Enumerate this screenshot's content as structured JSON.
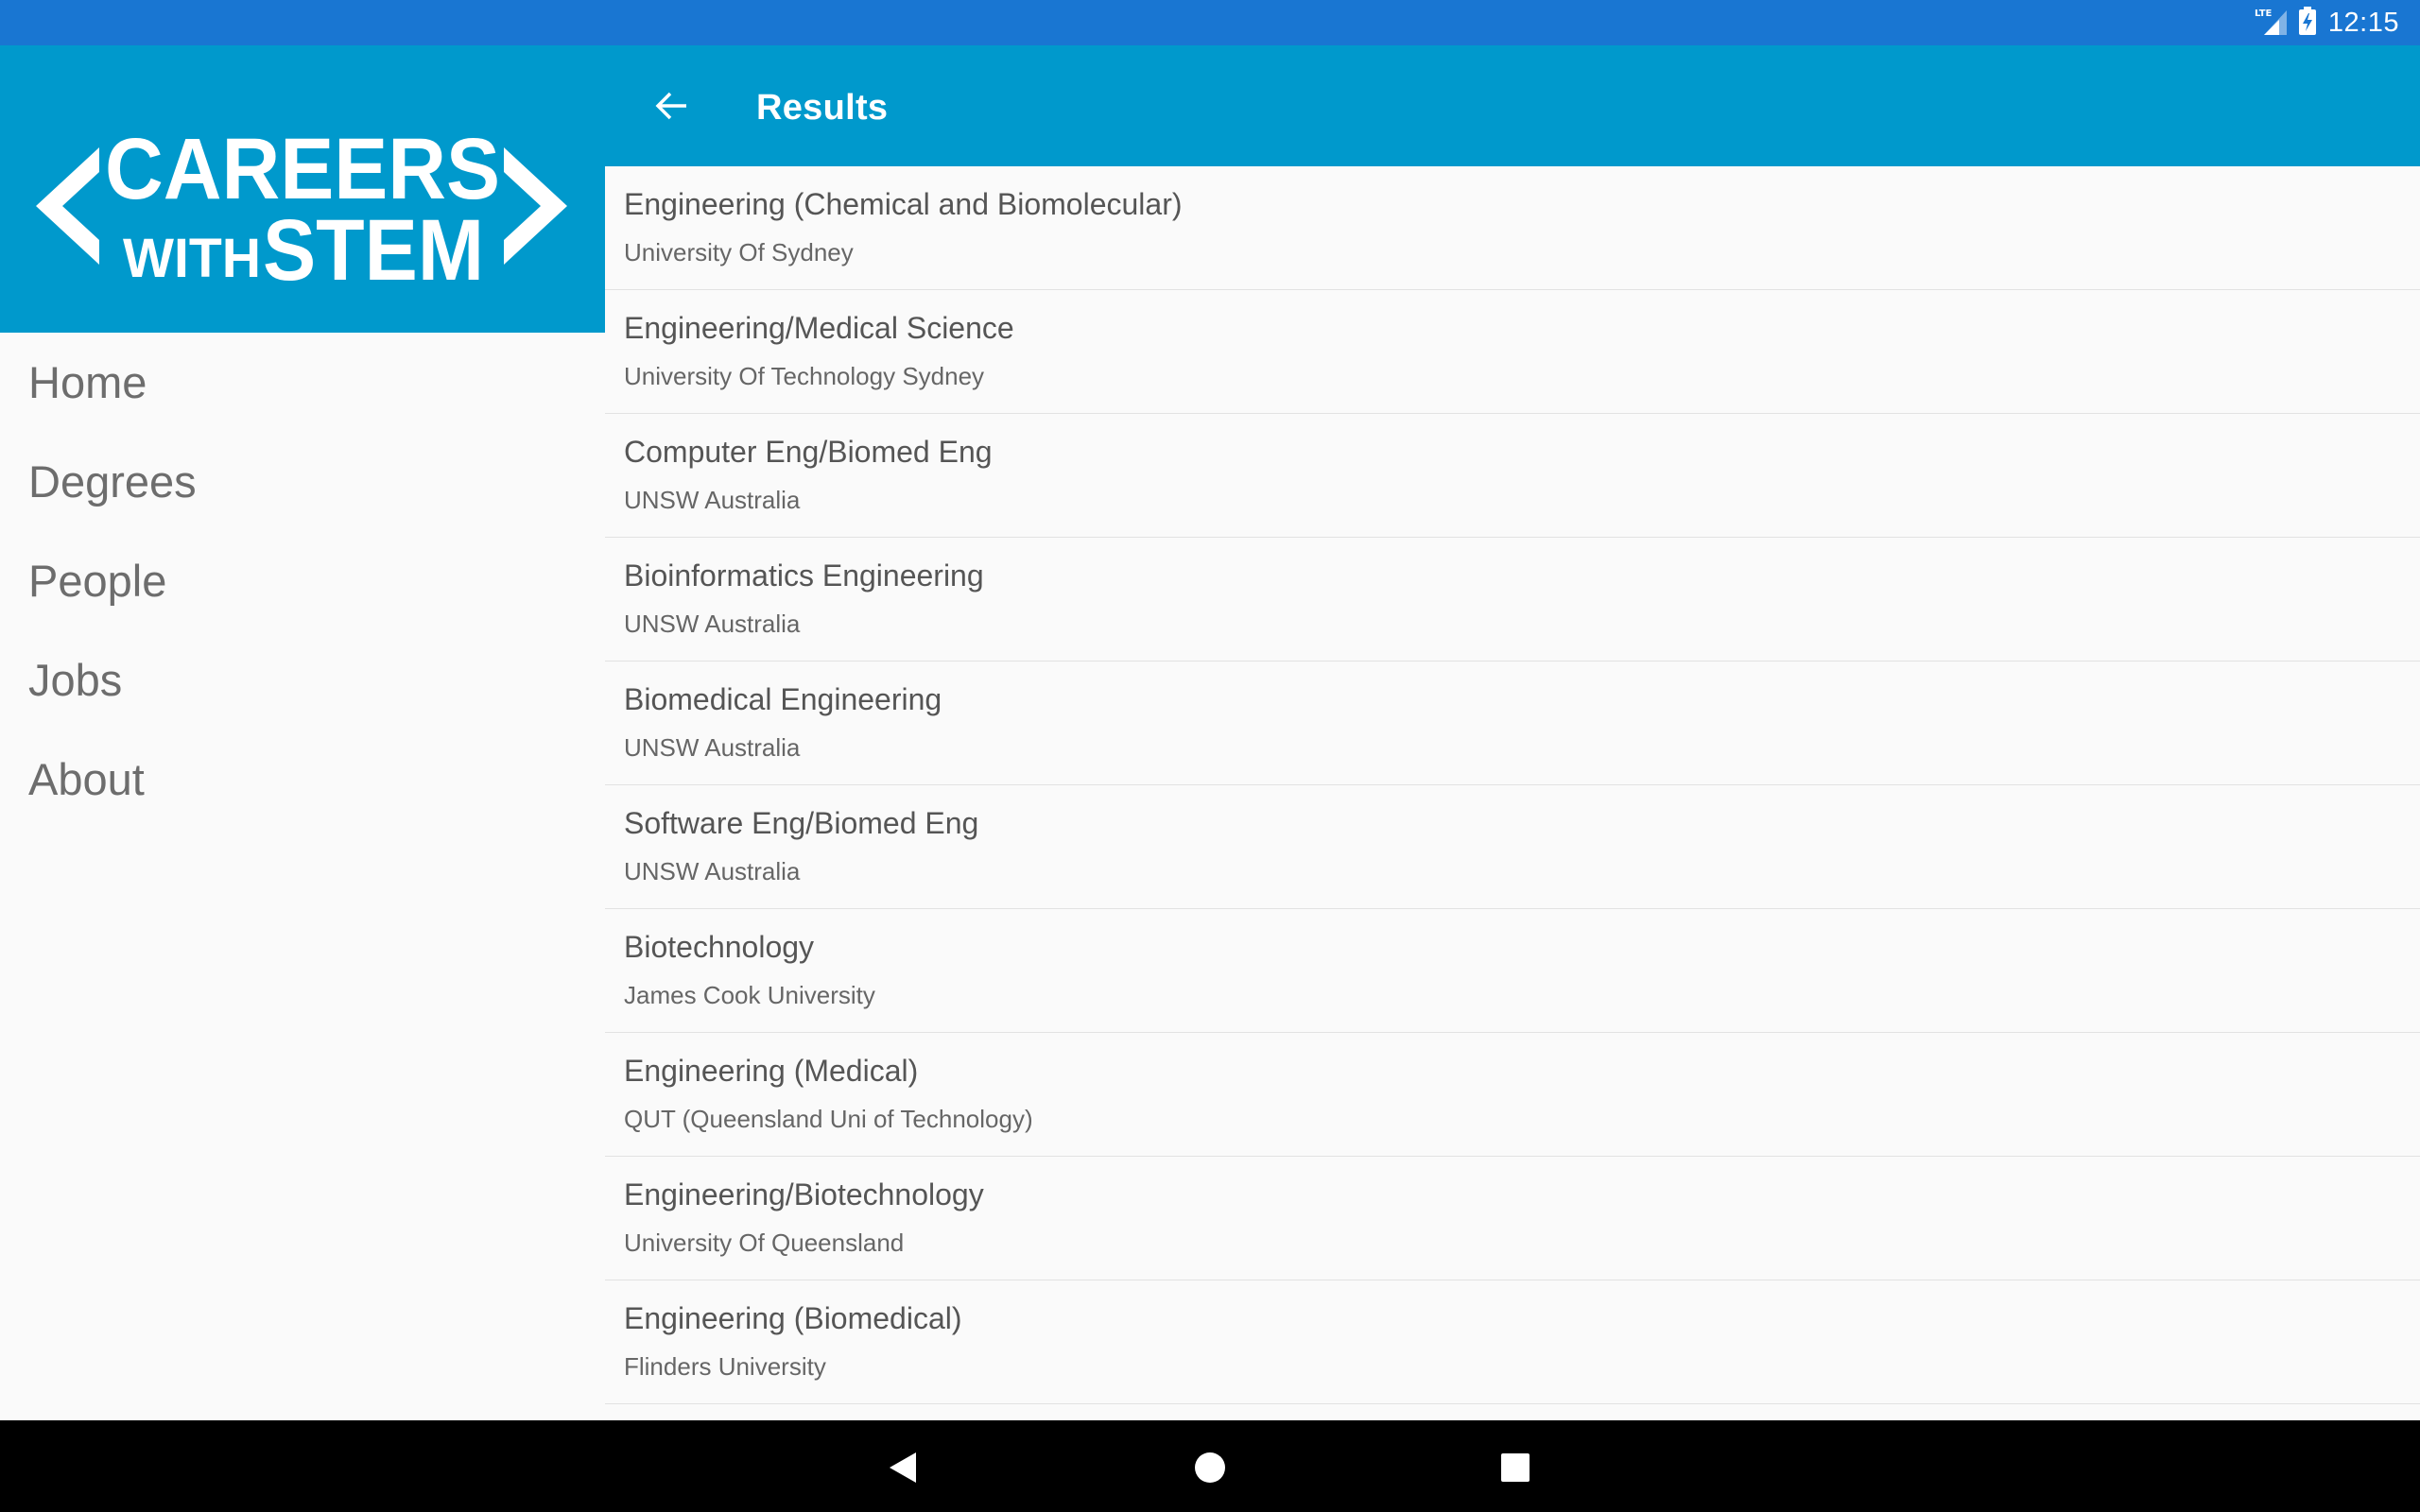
{
  "status_bar": {
    "network_label": "LTE",
    "time": "12:15",
    "color": "#1976d2"
  },
  "sidebar": {
    "logo": {
      "line1": "CAREERS",
      "line2_small": "WITH",
      "line2_big": "STEM",
      "background": "#0099cc"
    },
    "items": [
      {
        "label": "Home"
      },
      {
        "label": "Degrees"
      },
      {
        "label": "People"
      },
      {
        "label": "Jobs"
      },
      {
        "label": "About"
      }
    ]
  },
  "app_bar": {
    "title": "Results",
    "back_icon": "arrow-back-icon",
    "color": "#0099cc"
  },
  "results": [
    {
      "title": "Engineering (Chemical and Biomolecular)",
      "university": "University Of Sydney"
    },
    {
      "title": "Engineering/Medical Science",
      "university": "University Of Technology Sydney"
    },
    {
      "title": "Computer Eng/Biomed Eng",
      "university": "UNSW Australia"
    },
    {
      "title": "Bioinformatics Engineering",
      "university": "UNSW Australia"
    },
    {
      "title": "Biomedical Engineering",
      "university": "UNSW Australia"
    },
    {
      "title": "Software Eng/Biomed Eng",
      "university": "UNSW Australia"
    },
    {
      "title": "Biotechnology",
      "university": "James Cook University"
    },
    {
      "title": "Engineering (Medical)",
      "university": "QUT (Queensland Uni of Technology)"
    },
    {
      "title": "Engineering/Biotechnology",
      "university": "University Of Queensland"
    },
    {
      "title": "Engineering (Biomedical)",
      "university": "Flinders University"
    }
  ],
  "system_nav": {
    "back_icon": "triangle-back-icon",
    "home_icon": "circle-home-icon",
    "recents_icon": "square-recents-icon"
  }
}
